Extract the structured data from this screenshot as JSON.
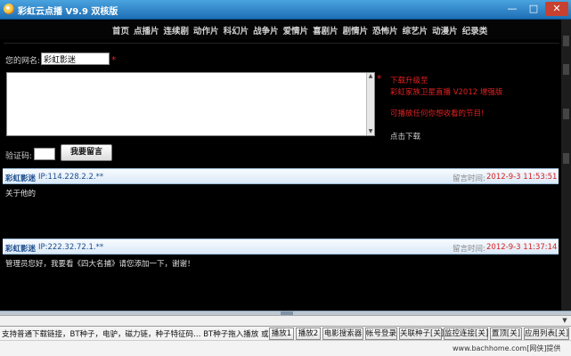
{
  "window": {
    "title": "彩虹云点播 V9.9 双核版",
    "min_icon": "minimize-icon",
    "max_icon": "maximize-icon",
    "close_icon": "close-icon",
    "min_glyph": "—",
    "max_glyph": "□",
    "close_glyph": "✕"
  },
  "nav": {
    "items": [
      "首页",
      "点播片",
      "连续剧",
      "动作片",
      "科幻片",
      "战争片",
      "爱情片",
      "喜剧片",
      "剧情片",
      "恐怖片",
      "综艺片",
      "动漫片",
      "纪录类"
    ]
  },
  "form": {
    "nickname_label": "您的网名:",
    "nickname_value": "彩虹影迷",
    "required_mark": "*",
    "tip_mark": "*",
    "tips": [
      "下载升级至",
      "彩虹家族卫星直播 V2012 增强版",
      "可播放任何你想收看的节目!",
      "点击下载"
    ],
    "captcha_label": "验证码:",
    "submit_label": "我要留言"
  },
  "comments": [
    {
      "user": "彩虹影迷",
      "ip": "IP:114.228.2.2.**",
      "time_label": "留言时间:",
      "time": "2012-9-3 11:53:51",
      "body": "关于他的"
    },
    {
      "user": "彩虹影迷",
      "ip": "IP:222.32.72.1.**",
      "time_label": "留言时间:",
      "time": "2012-9-3 11:37:14",
      "body": "管理员您好，我要看《四大名捕》请您添加一下，谢谢！"
    }
  ],
  "status": {
    "note": "支持普通下载链接，BT种子，电驴，磁力链，种子特征码… BT种子拖入播放 或 关联种",
    "buttons": [
      "播放1",
      "播放2",
      "电影搜索器",
      "帐号登录",
      "关联种子[关]",
      "监控连接[关]",
      "置顶[关]",
      "应用列表[关]"
    ]
  },
  "watermark": "www.bachhome.com[网侠]提供"
}
